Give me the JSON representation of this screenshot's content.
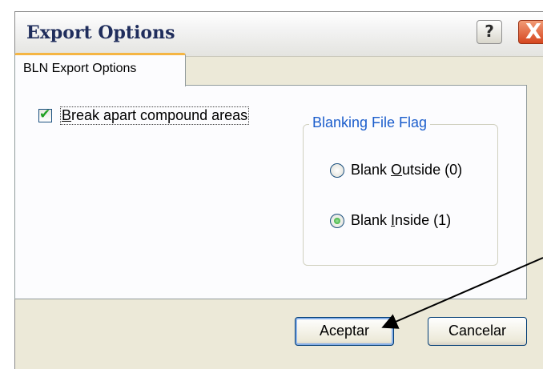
{
  "dialog": {
    "title": "Export Options",
    "help_label": "?",
    "close_label": "X"
  },
  "tabs": [
    {
      "label": "BLN Export Options",
      "active": true
    }
  ],
  "options": {
    "break_apart": {
      "label_prefix": "B",
      "label_rest": "reak apart compound areas",
      "checked": true
    }
  },
  "blanking_group": {
    "title": "Blanking File Flag",
    "radios": [
      {
        "prefix": "Blank ",
        "mnemonic": "O",
        "rest": "utside (0)",
        "selected": false
      },
      {
        "prefix": "Blank ",
        "mnemonic": "I",
        "rest": "nside (1)",
        "selected": true
      }
    ]
  },
  "buttons": {
    "ok": "Aceptar",
    "cancel": "Cancelar"
  },
  "colors": {
    "accent_tab": "#f5b543",
    "group_title": "#1c5ecc",
    "check": "#21a121",
    "close": "#d6461f"
  },
  "annotations": {
    "arrow": "red-black-callout-arrow"
  }
}
